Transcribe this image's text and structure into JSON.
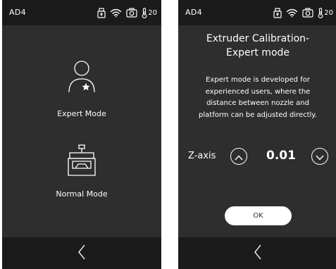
{
  "status_bar": {
    "model": "AD4",
    "icons": [
      "usb-icon",
      "wifi-icon",
      "camera-icon",
      "thermometer-icon"
    ],
    "temperature": "20"
  },
  "left_screen": {
    "options": [
      {
        "label": "Expert Mode",
        "icon": "user-star-icon"
      },
      {
        "label": "Normal Mode",
        "icon": "printer-icon"
      }
    ]
  },
  "right_screen": {
    "title_line1": "Extruder Calibration-",
    "title_line2": "Expert mode",
    "description_lines": [
      "Expert mode is developed for",
      "experienced users, where the",
      "distance between nozzle and",
      "platform can be adjusted directly."
    ],
    "zaxis_label": "Z-axis",
    "zaxis_value": "0.01",
    "ok_label": "OK"
  },
  "colors": {
    "panel": "#2e2e2e",
    "bar": "#1b1b1b",
    "text": "#ffffff"
  }
}
